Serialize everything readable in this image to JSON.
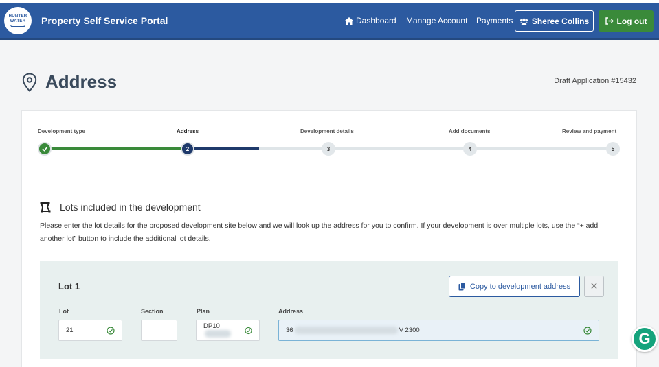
{
  "header": {
    "logo_line1": "HUNTER",
    "logo_line2": "WATER",
    "app_title": "Property Self Service Portal",
    "nav": {
      "dashboard": "Dashboard",
      "manage_account": "Manage Account",
      "payments": "Payments"
    },
    "user_name": "Sheree Collins",
    "logout": "Log out",
    "colors": {
      "brand": "#2c5aa0",
      "logout": "#3a8a3a"
    }
  },
  "page": {
    "title": "Address",
    "draft": "Draft Application #15432"
  },
  "stepper": {
    "steps": [
      {
        "label": "Development type",
        "marker": "",
        "state": "done"
      },
      {
        "label": "Address",
        "marker": "2",
        "state": "active"
      },
      {
        "label": "Development details",
        "marker": "3",
        "state": "todo"
      },
      {
        "label": "Add documents",
        "marker": "4",
        "state": "todo"
      },
      {
        "label": "Review and payment",
        "marker": "5",
        "state": "todo"
      }
    ]
  },
  "lots": {
    "heading": "Lots included in the development",
    "description": "Please enter the lot details for the proposed development site below and we will look up the address for you to confirm. If your development is over multiple lots, use the “+ add another lot” button to include the additional lot details.",
    "lot": {
      "title": "Lot 1",
      "copy_button": "Copy to development address",
      "close_button": "✕",
      "labels": {
        "lot": "Lot",
        "section": "Section",
        "plan": "Plan",
        "address": "Address"
      },
      "values": {
        "lot": "21",
        "section": "",
        "plan": "DP10",
        "address_start": "36",
        "address_end": "V 2300"
      }
    }
  },
  "grammarly": "G"
}
